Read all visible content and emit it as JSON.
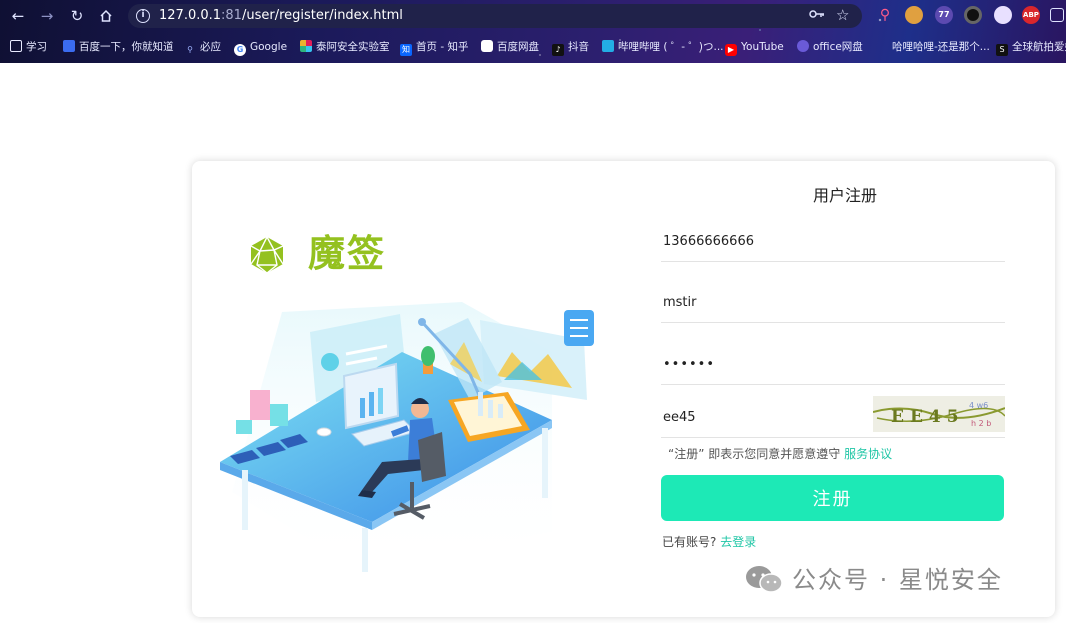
{
  "browser": {
    "url_host": "127.0.0.1",
    "url_port": ":81",
    "url_path": "/user/register/index.html",
    "info_symbol": "i",
    "extension_badge": "77",
    "abp_label": "ABP",
    "bookmarks": [
      {
        "label": "学习",
        "icon": "folder-icon"
      },
      {
        "label": "百度一下，你就知道",
        "icon": "baidu-icon"
      },
      {
        "label": "必应",
        "icon": "bing-icon"
      },
      {
        "label": "Google",
        "icon": "google-icon"
      },
      {
        "label": "泰阿安全实验室",
        "icon": "slack-icon"
      },
      {
        "label": "首页 - 知乎",
        "icon": "zhihu-icon"
      },
      {
        "label": "百度网盘",
        "icon": "baidu-pan-icon"
      },
      {
        "label": "抖音",
        "icon": "douyin-icon"
      },
      {
        "label": "哔哩哔哩 ( ゜- ゜)つ...",
        "icon": "bilibili-icon"
      },
      {
        "label": "YouTube",
        "icon": "youtube-icon"
      },
      {
        "label": "office网盘",
        "icon": "office-icon"
      },
      {
        "label": "哈哩哈哩-还是那个...",
        "icon": "hali-icon"
      },
      {
        "label": "全球航拍爱好...",
        "icon": "skypixel-icon"
      }
    ],
    "zhihu_icon_glyph": "知",
    "skypixel_icon_glyph": "S"
  },
  "brand": {
    "name": "魔签",
    "color": "#94c11f"
  },
  "form": {
    "title": "用户注册",
    "phone_value": "13666666666",
    "username_value": "mstir",
    "password_value": "mstir1",
    "captcha_value": "ee45",
    "captcha_text": "EE45",
    "agree_prefix": "“注册” 即表示您同意并愿意遵守 ",
    "agree_link": "服务协议",
    "submit_label": "注册",
    "login_prefix": "已有账号? ",
    "login_link": "去登录",
    "accent_color": "#1de9b6",
    "link_color": "#1fc6a6"
  },
  "watermark": {
    "text": "公众号 · 星悦安全"
  }
}
